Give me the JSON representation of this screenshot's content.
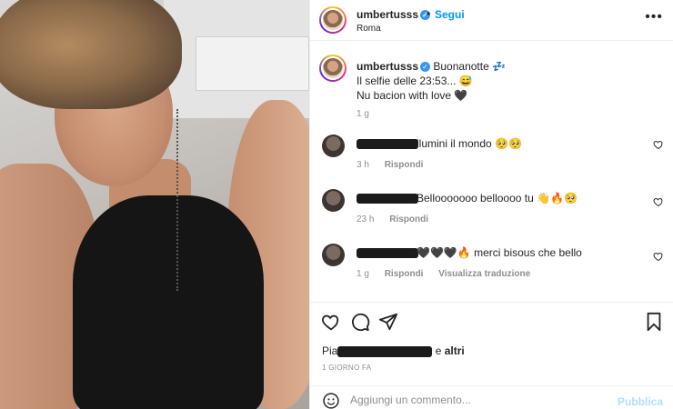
{
  "post": {
    "username": "umbertusss",
    "verified_icon": "verified-badge-icon",
    "follow_label": "Segui",
    "separator": "•",
    "location": "Roma",
    "more_label": "•••"
  },
  "caption": {
    "username": "umbertusss",
    "line1": "Buonanotte 💤",
    "line2": "Il selfie delle 23:53... 😅",
    "line3": "Nu bacion with love 🖤",
    "time": "1 g"
  },
  "comments": [
    {
      "text": "llumini il mondo 🥺🥺",
      "time": "3 h",
      "reply_label": "Rispondi",
      "translate_label": ""
    },
    {
      "text": "Bellooooooo belloooo tu 👋🔥🥺",
      "time": "23 h",
      "reply_label": "Rispondi",
      "translate_label": ""
    },
    {
      "text": "🖤🖤🖤🔥 merci bisous che bello",
      "time": "1 g",
      "reply_label": "Rispondi",
      "translate_label": "Visualizza traduzione"
    }
  ],
  "likes": {
    "prefix": "Pia",
    "suffix": "e",
    "others": "altri"
  },
  "date_label": "1 GIORNO FA",
  "add_comment": {
    "placeholder": "Aggiungi un commento...",
    "post_label": "Pubblica"
  },
  "colors": {
    "accent": "#0095f6",
    "muted": "#8e8e8e",
    "post_disabled": "#b2dffc"
  }
}
